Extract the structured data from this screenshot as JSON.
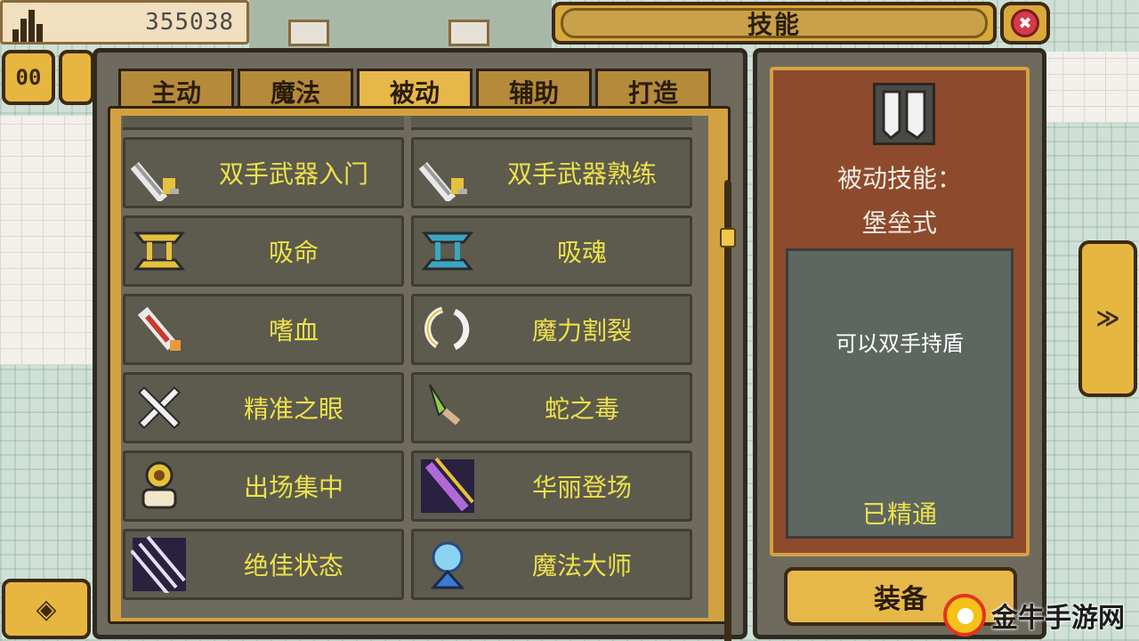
{
  "hud": {
    "gold_value": "355038"
  },
  "title": "技能",
  "close_symbol": "✖",
  "pause_label": "00",
  "tabs": [
    {
      "label": "主动",
      "active": false
    },
    {
      "label": "魔法",
      "active": false
    },
    {
      "label": "被动",
      "active": true
    },
    {
      "label": "辅助",
      "active": false
    },
    {
      "label": "打造",
      "active": false
    }
  ],
  "skills": [
    {
      "name": "双手武器入门",
      "icon": "greatsword-icon"
    },
    {
      "name": "双手武器熟练",
      "icon": "greatsword-icon"
    },
    {
      "name": "吸命",
      "icon": "fang-yellow-icon"
    },
    {
      "name": "吸魂",
      "icon": "fang-blue-icon"
    },
    {
      "name": "嗜血",
      "icon": "blood-blade-icon"
    },
    {
      "name": "魔力割裂",
      "icon": "broken-ring-icon"
    },
    {
      "name": "精准之眼",
      "icon": "crossed-swords-icon"
    },
    {
      "name": "蛇之毒",
      "icon": "poison-dagger-icon"
    },
    {
      "name": "出场集中",
      "icon": "golden-eye-icon"
    },
    {
      "name": "华丽登场",
      "icon": "purple-slash-icon"
    },
    {
      "name": "绝佳状态",
      "icon": "triple-slash-icon"
    },
    {
      "name": "魔法大师",
      "icon": "magic-orb-icon"
    }
  ],
  "detail": {
    "type_label": "被动技能：",
    "skill_name": "堡垒式",
    "description": "可以双手持盾",
    "status": "已精通",
    "icon": "shield-pair-icon"
  },
  "equip_label": "装备",
  "next_label": "≫",
  "watermark": "金牛手游网",
  "colors": {
    "skill_text": "#ece24a",
    "gold_frame": "#d2a240",
    "detail_card": "#8e4a2c"
  }
}
